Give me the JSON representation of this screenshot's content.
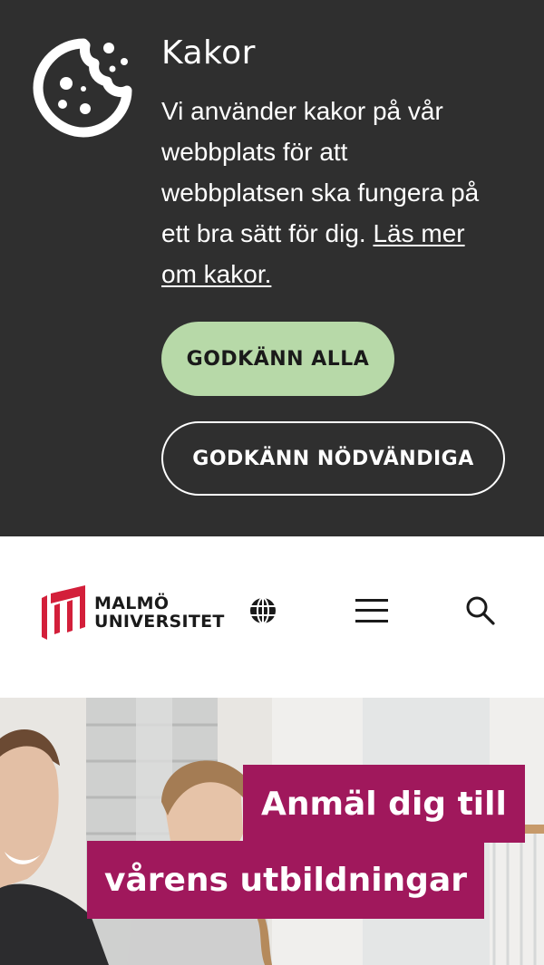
{
  "cookie_banner": {
    "icon": "cookie-icon",
    "title": "Kakor",
    "text": "Vi använder kakor på vår webbplats för att webbplatsen ska fungera på ett bra sätt för dig. ",
    "link_label": "Läs mer om kakor.",
    "accept_all_label": "GODKÄNN ALLA",
    "accept_necessary_label": "GODKÄNN NÖDVÄNDIGA",
    "colors": {
      "background": "#2f2f2f",
      "accept_all": "#b7d9a8"
    }
  },
  "header": {
    "logo_line1": "MALMÖ",
    "logo_line2": "UNIVERSITET",
    "icons": [
      "globe-icon",
      "hamburger-menu-icon",
      "search-icon"
    ],
    "colors": {
      "logo_red": "#d31f3a"
    }
  },
  "hero": {
    "headline_line1": "Anmäl dig till",
    "headline_line2": "vårens utbildningar",
    "colors": {
      "headline_bg": "#a0185c"
    }
  }
}
